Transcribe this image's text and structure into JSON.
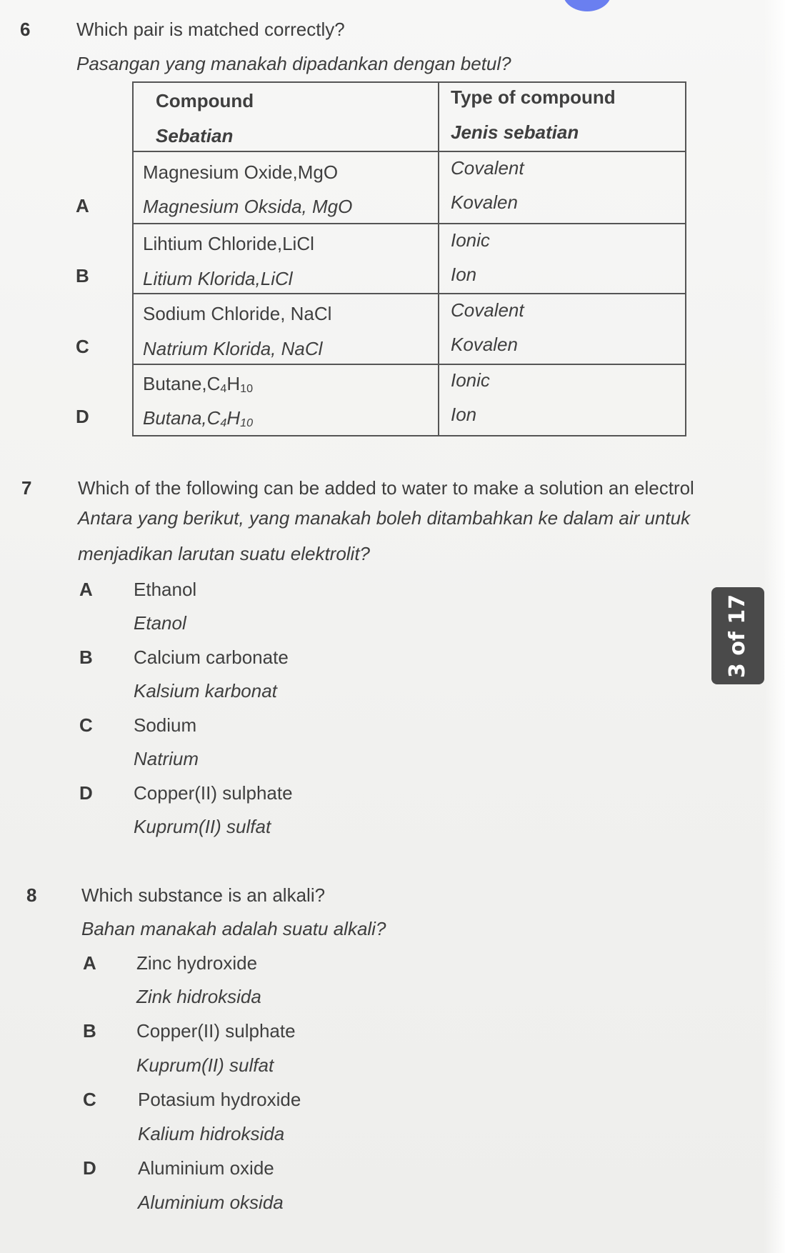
{
  "page_indicator": "3 of 17",
  "questions": [
    {
      "number": "6",
      "text_en": "Which pair is matched correctly?",
      "text_ms": "Pasangan yang manakah dipadankan dengan betul?",
      "table": {
        "headers": {
          "compound_en": "Compound",
          "compound_ms": "Sebatian",
          "type_en": "Type of compound",
          "type_ms": "Jenis sebatian"
        },
        "rows": [
          {
            "letter": "A",
            "compound_en": "Magnesium Oxide,MgO",
            "compound_ms": "Magnesium Oksida,  MgO",
            "type_en": "Covalent",
            "type_ms": "Kovalen"
          },
          {
            "letter": "B",
            "compound_en": "Lihtium Chloride,LiCl",
            "compound_ms": "Litium Klorida,LiCl",
            "type_en": "Ionic",
            "type_ms": "Ion"
          },
          {
            "letter": "C",
            "compound_en": "Sodium Chloride, NaCl",
            "compound_ms": "Natrium Klorida, NaCl",
            "type_en": "Covalent",
            "type_ms": "Kovalen"
          },
          {
            "letter": "D",
            "compound_en_prefix": "Butane,C",
            "compound_ms_prefix": "Butana,C",
            "sub_c": "4",
            "h": "H",
            "sub_h": "10",
            "type_en": "Ionic",
            "type_ms": "Ion"
          }
        ]
      }
    },
    {
      "number": "7",
      "text_en": "Which of the following can be added to water to make a solution an electrol",
      "text_ms_line1": "Antara yang berikut, yang manakah boleh ditambahkan ke dalam air untuk",
      "text_ms_line2": "menjadikan larutan suatu elektrolit?",
      "options": [
        {
          "letter": "A",
          "en": "Ethanol",
          "ms": "Etanol"
        },
        {
          "letter": "B",
          "en": "Calcium carbonate",
          "ms": "Kalsium karbonat"
        },
        {
          "letter": "C",
          "en": "Sodium",
          "ms": "Natrium"
        },
        {
          "letter": "D",
          "en": "Copper(II) sulphate",
          "ms": "Kuprum(II) sulfat"
        }
      ]
    },
    {
      "number": "8",
      "text_en": "Which substance is an alkali?",
      "text_ms": "Bahan manakah adalah suatu alkali?",
      "options": [
        {
          "letter": "A",
          "en": "Zinc hydroxide",
          "ms": "Zink hidroksida"
        },
        {
          "letter": "B",
          "en": "Copper(II) sulphate",
          "ms": "Kuprum(II) sulfat"
        },
        {
          "letter": "C",
          "en": "Potasium hydroxide",
          "ms": "Kalium hidroksida"
        },
        {
          "letter": "D",
          "en": "Aluminium oxide",
          "ms": "Aluminium oksida"
        }
      ]
    }
  ]
}
